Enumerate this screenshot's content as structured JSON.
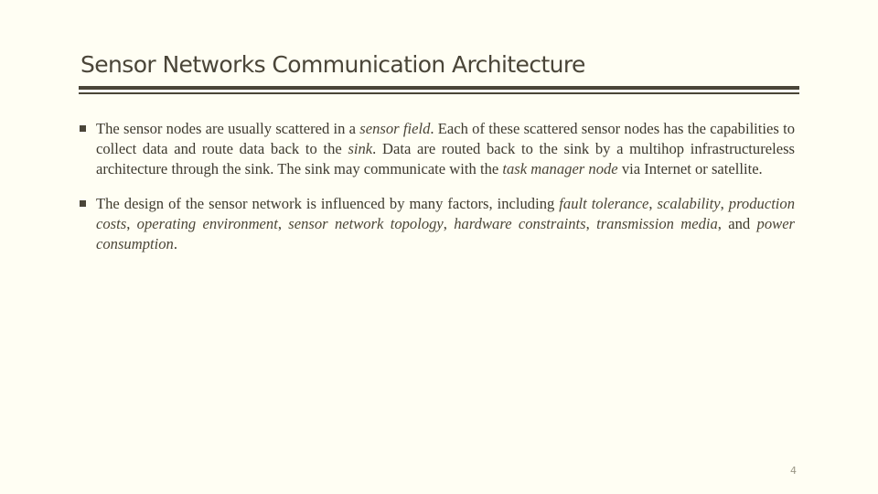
{
  "slide": {
    "title": "Sensor Networks Communication Architecture",
    "page_number": "4"
  },
  "bullets": [
    {
      "segments": [
        {
          "text": "The sensor nodes are usually scattered in a ",
          "italic": false
        },
        {
          "text": "sensor field",
          "italic": true
        },
        {
          "text": ". Each of these scattered sensor nodes has the capabilities to collect data and route data back to the ",
          "italic": false
        },
        {
          "text": "sink",
          "italic": true
        },
        {
          "text": ". Data are routed back to the sink by a multihop infrastructureless architecture through the sink. The sink may communicate with the ",
          "italic": false
        },
        {
          "text": "task manager node",
          "italic": true
        },
        {
          "text": " via Internet or satellite.",
          "italic": false
        }
      ]
    },
    {
      "segments": [
        {
          "text": "The design of the sensor network is influenced by many factors, including ",
          "italic": false
        },
        {
          "text": "fault tolerance",
          "italic": true
        },
        {
          "text": ", ",
          "italic": false
        },
        {
          "text": "scalability",
          "italic": true
        },
        {
          "text": ", ",
          "italic": false
        },
        {
          "text": "production costs",
          "italic": true
        },
        {
          "text": ", ",
          "italic": false
        },
        {
          "text": "operating environment",
          "italic": true
        },
        {
          "text": ", ",
          "italic": false
        },
        {
          "text": "sensor network topology",
          "italic": true
        },
        {
          "text": ", ",
          "italic": false
        },
        {
          "text": "hardware constraints",
          "italic": true
        },
        {
          "text": ", ",
          "italic": false
        },
        {
          "text": "transmission media",
          "italic": true
        },
        {
          "text": ", and ",
          "italic": false
        },
        {
          "text": "power consumption",
          "italic": true
        },
        {
          "text": ".",
          "italic": false
        }
      ]
    }
  ]
}
